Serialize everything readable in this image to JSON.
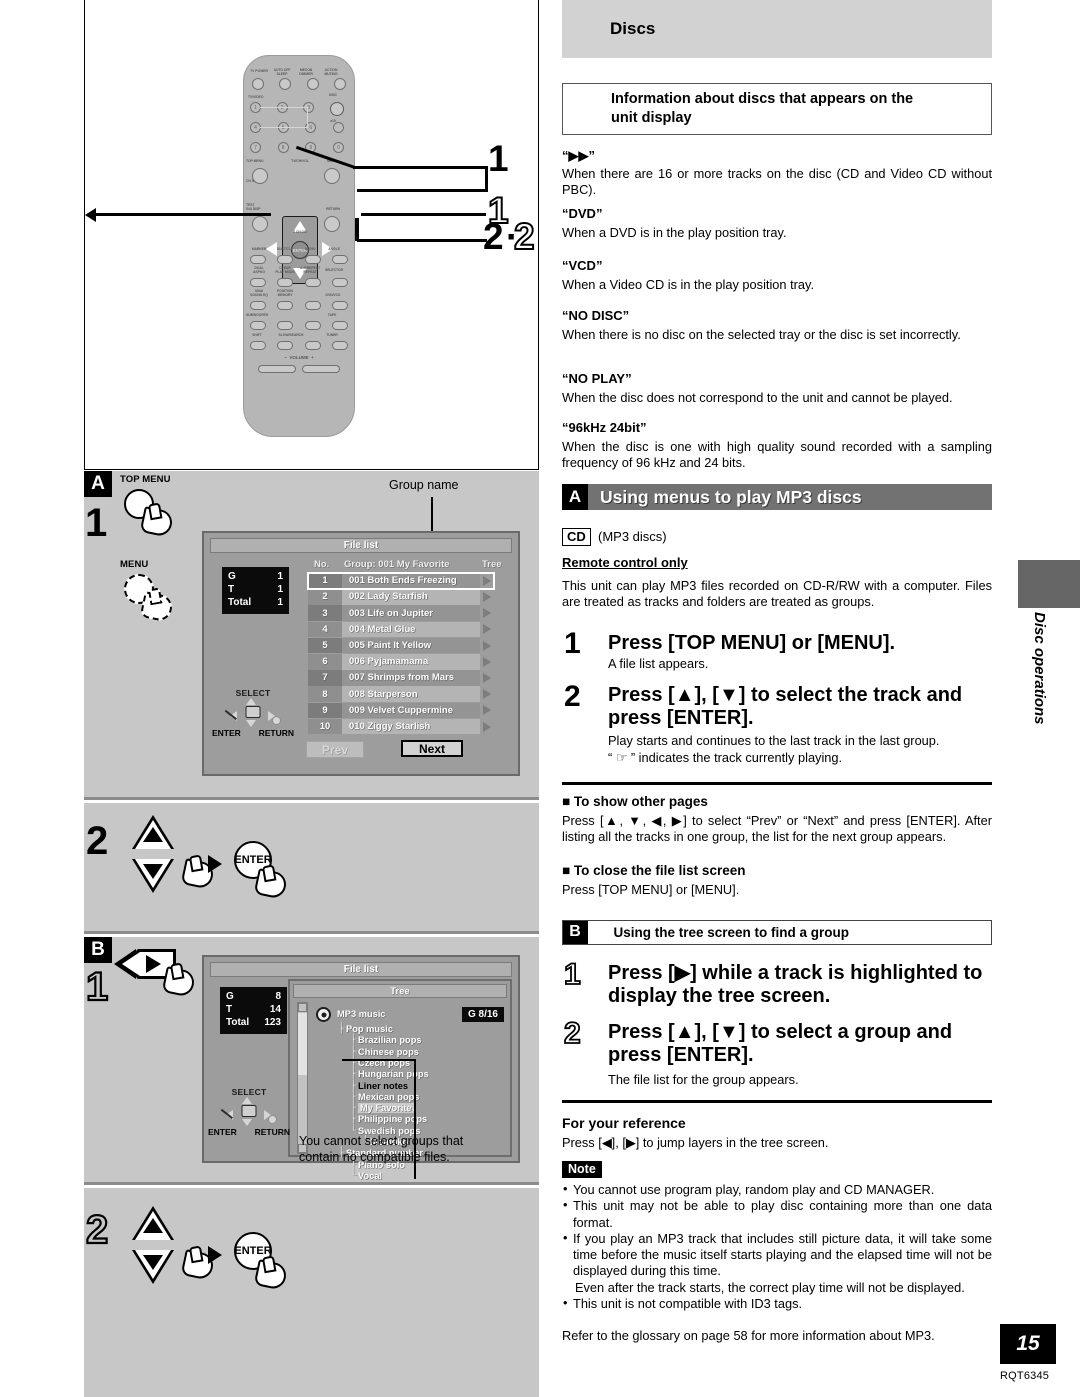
{
  "left": {
    "remote": {
      "labels_row1": [
        "TV POWER",
        "AUTO OFF\nSLEEP",
        "MECON\nDIMMER",
        "ACTION\nMUTING"
      ],
      "tv_video_label": "TV/VIDEO",
      "disc_label": "DISC",
      "disc_sub": "≥10",
      "numbers": [
        "1",
        "2",
        "3",
        "4",
        "5",
        "6",
        "7",
        "8",
        "9",
        "0"
      ],
      "top_menu": "TOP MENU",
      "menu": "MENU",
      "ch_select": "CH SELECT",
      "tv_ch_vol": "TV CH/VOL",
      "v_ch_dir": "V CH DIR",
      "enter": "ENTER",
      "test_gui": "TEST\nGUI DISP",
      "return": "RETURN",
      "labels_row_marker": [
        "MARKER",
        "SUBTITLE",
        "AUDIO",
        "ANGLE"
      ],
      "labels_row_dual": [
        "DUAL\n&SPKG",
        "CLEAR\nPLAY MODE",
        "A-B/REPEAT\nREPEAT",
        "SELECTOR"
      ],
      "labels_row_3d": [
        "3D/AI\nSOUND EQ",
        "POSITION\nMEMORY",
        "",
        "DVD/VCD"
      ],
      "labels_row_sub": [
        "SUBWOOFER",
        "",
        "",
        "TAPE"
      ],
      "labels_row_shift": [
        "SHIFT",
        "SLOW/SEARCH",
        "TUNER"
      ],
      "volume": "VOLUME"
    },
    "callouts": {
      "one_solid": "1",
      "one_hollow": "1",
      "two_solid": "2",
      "dot": "·",
      "two_hollow": "2"
    },
    "section_a": {
      "letter": "A",
      "step1": "1",
      "top_menu_label": "TOP MENU",
      "menu_label": "MENU",
      "group_name_callout": "Group name"
    },
    "filelist": {
      "title": "File list",
      "col_no": "No.",
      "col_group": "Group: 001 My Favorite",
      "col_tree": "Tree",
      "counters": [
        {
          "k": "G",
          "v": "1"
        },
        {
          "k": "T",
          "v": "1"
        },
        {
          "k": "Total",
          "v": "1"
        }
      ],
      "rows": [
        {
          "no": "1",
          "name": "001 Both Ends Freezing",
          "selected": true
        },
        {
          "no": "2",
          "name": "002 Lady Starfish",
          "selected": false
        },
        {
          "no": "3",
          "name": "003 Life on Jupiter",
          "selected": false
        },
        {
          "no": "4",
          "name": "004 Metal Glue",
          "selected": false
        },
        {
          "no": "5",
          "name": "005 Paint It Yellow",
          "selected": false
        },
        {
          "no": "6",
          "name": "006 Pyjamamama",
          "selected": false
        },
        {
          "no": "7",
          "name": "007 Shrimps from Mars",
          "selected": false
        },
        {
          "no": "8",
          "name": "008 Starperson",
          "selected": false
        },
        {
          "no": "9",
          "name": "009 Velvet Cuppermine",
          "selected": false
        },
        {
          "no": "10",
          "name": "010 Ziggy Starlish",
          "selected": false
        }
      ],
      "prev": "Prev",
      "next": "Next",
      "select_label": "SELECT",
      "enter_label": "ENTER",
      "return_label": "RETURN"
    },
    "step2": {
      "num": "2",
      "enter": "ENTER"
    },
    "section_b": {
      "letter": "B",
      "step1": "1",
      "step2": "2",
      "enter": "ENTER"
    },
    "treescreen": {
      "title": "File list",
      "tree_title": "Tree",
      "counters": [
        {
          "k": "G",
          "v": "8"
        },
        {
          "k": "T",
          "v": "14"
        },
        {
          "k": "Total",
          "v": "123"
        }
      ],
      "group_badge": "G  8/16",
      "root": "MP3 music",
      "items": [
        {
          "label": "Pop music",
          "indent": 0,
          "style": "normal"
        },
        {
          "label": "Brazilian pops",
          "indent": 1,
          "style": "normal"
        },
        {
          "label": "Chinese pops",
          "indent": 1,
          "style": "normal"
        },
        {
          "label": "Czech pops",
          "indent": 1,
          "style": "normal"
        },
        {
          "label": "Hungarian pops",
          "indent": 1,
          "style": "normal"
        },
        {
          "label": "Liner notes",
          "indent": 1,
          "style": "black"
        },
        {
          "label": "Mexican pops",
          "indent": 1,
          "style": "normal"
        },
        {
          "label": "My Favorite",
          "indent": 1,
          "style": "highlight"
        },
        {
          "label": "Philippine pops",
          "indent": 1,
          "style": "normal"
        },
        {
          "label": "Swedish pops",
          "indent": 1,
          "style": "normal"
        },
        {
          "label": "Momoko",
          "indent": 2,
          "style": "normal"
        },
        {
          "label": "Standard number",
          "indent": 0,
          "style": "normal"
        },
        {
          "label": "Piano solo",
          "indent": 1,
          "style": "normal"
        },
        {
          "label": "Vocal",
          "indent": 1,
          "style": "normal"
        }
      ],
      "select_label": "SELECT",
      "enter_label": "ENTER",
      "return_label": "RETURN"
    },
    "note_callout": "You cannot select groups that\ncontain no compatible files.",
    "step2b": {
      "num": "2",
      "enter": "ENTER"
    }
  },
  "right": {
    "discs_band": "Discs",
    "info_box": "Information about discs that appears on the\nunit display",
    "terms": [
      {
        "term": "“▶▶”",
        "body": "When there are 16 or more tracks on the disc (CD and Video CD without PBC)."
      },
      {
        "term": "“DVD”",
        "body": "When a DVD is in the play position tray."
      },
      {
        "term": "“VCD”",
        "body": "When a Video CD is in the play position tray."
      },
      {
        "term": "“NO DISC”",
        "body": "When there is no disc on the selected tray or the disc is set incorrectly."
      },
      {
        "term": "“NO PLAY”",
        "body": "When the disc does not correspond to the unit and cannot be played."
      },
      {
        "term": "“96kHz 24bit”",
        "body": "When the disc is one with high quality sound recorded with a sampling frequency of 96 kHz and 24 bits."
      }
    ],
    "section_a": {
      "letter": "A",
      "title": "Using menus to play MP3 discs",
      "cd_tag": "CD",
      "cd_note": "(MP3 discs)",
      "remote_only": "Remote control only",
      "intro": "This unit can play MP3 files recorded on CD-R/RW with a computer. Files are treated as tracks and folders are treated as groups.",
      "step1_num": "1",
      "step1_head": "Press [TOP MENU] or [MENU].",
      "step1_sub": "A file list appears.",
      "step2_num": "2",
      "step2_head": "Press [▲], [▼] to select the track and press [ENTER].",
      "step2_sub1": "Play starts and continues to the last track in the last group.",
      "step2_sub2": "“ ☞ ” indicates the track currently playing.",
      "sub1_head": "■ To show other pages",
      "sub1_body": "Press [▲, ▼, ◀, ▶] to select “Prev” or “Next” and press [ENTER]. After listing all the tracks in one group, the list for the next group appears.",
      "sub2_head": "■ To close the file list screen",
      "sub2_body": "Press [TOP MENU] or [MENU]."
    },
    "section_b": {
      "letter": "B",
      "title": "Using the tree screen to find a group",
      "step1_num": "1",
      "step1_head": "Press [▶] while a track is highlighted to display the tree screen.",
      "step2_num": "2",
      "step2_head": "Press [▲], [▼] to select a group and press [ENTER].",
      "step2_sub": "The file list for the group appears."
    },
    "reference": {
      "head": "For your reference",
      "body": "Press [◀], [▶] to jump layers in the tree screen."
    },
    "note": {
      "tag": "Note",
      "items": [
        "You cannot use program play, random play and CD MANAGER.",
        "This unit may not be able to play disc containing more than one data format.",
        "If you play an MP3 track that includes still picture data, it will take some time before the music itself starts playing and the elapsed time will not be displayed during this time.",
        "This unit is not compatible with ID3 tags."
      ],
      "extra_line": "Even after the track starts, the correct play time will not be displayed."
    },
    "glossary": "Refer to the glossary on page 58 for more information about MP3.",
    "side_label": "Disc operations",
    "page_number": "15",
    "rqt": "RQT6345"
  }
}
